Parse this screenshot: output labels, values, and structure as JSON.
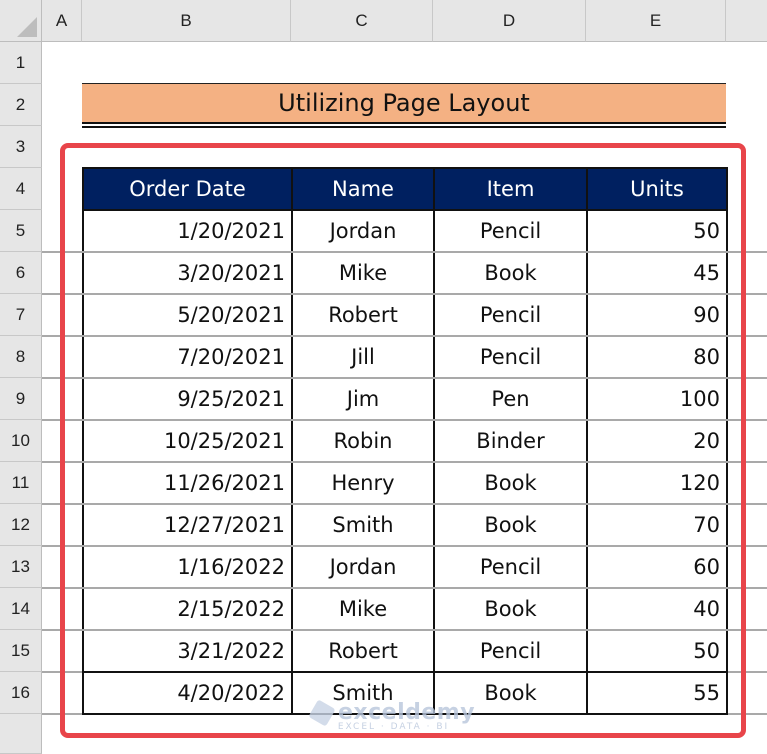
{
  "sheet": {
    "columns": [
      "A",
      "B",
      "C",
      "D",
      "E"
    ],
    "rows": [
      "1",
      "2",
      "3",
      "4",
      "5",
      "6",
      "7",
      "8",
      "9",
      "10",
      "11",
      "12",
      "13",
      "14",
      "15",
      "16"
    ]
  },
  "title": "Utilizing Page Layout",
  "table": {
    "headers": [
      "Order Date",
      "Name",
      "Item",
      "Units"
    ],
    "rows": [
      {
        "date": "1/20/2021",
        "name": "Jordan",
        "item": "Pencil",
        "units": "50"
      },
      {
        "date": "3/20/2021",
        "name": "Mike",
        "item": "Book",
        "units": "45"
      },
      {
        "date": "5/20/2021",
        "name": "Robert",
        "item": "Pencil",
        "units": "90"
      },
      {
        "date": "7/20/2021",
        "name": "Jill",
        "item": "Pencil",
        "units": "80"
      },
      {
        "date": "9/25/2021",
        "name": "Jim",
        "item": "Pen",
        "units": "100"
      },
      {
        "date": "10/25/2021",
        "name": "Robin",
        "item": "Binder",
        "units": "20"
      },
      {
        "date": "11/26/2021",
        "name": "Henry",
        "item": "Book",
        "units": "120"
      },
      {
        "date": "12/27/2021",
        "name": "Smith",
        "item": "Book",
        "units": "70"
      },
      {
        "date": "1/16/2022",
        "name": "Jordan",
        "item": "Pencil",
        "units": "60"
      },
      {
        "date": "2/15/2022",
        "name": "Mike",
        "item": "Book",
        "units": "40"
      },
      {
        "date": "3/21/2022",
        "name": "Robert",
        "item": "Pencil",
        "units": "50"
      },
      {
        "date": "4/20/2022",
        "name": "Smith",
        "item": "Book",
        "units": "55"
      }
    ]
  },
  "colors": {
    "header_fill": "#002060",
    "title_fill": "#f4b183",
    "highlight_box": "#e8454a"
  },
  "watermark": {
    "logo": "exceldemy",
    "tagline": "EXCEL · DATA · BI"
  }
}
